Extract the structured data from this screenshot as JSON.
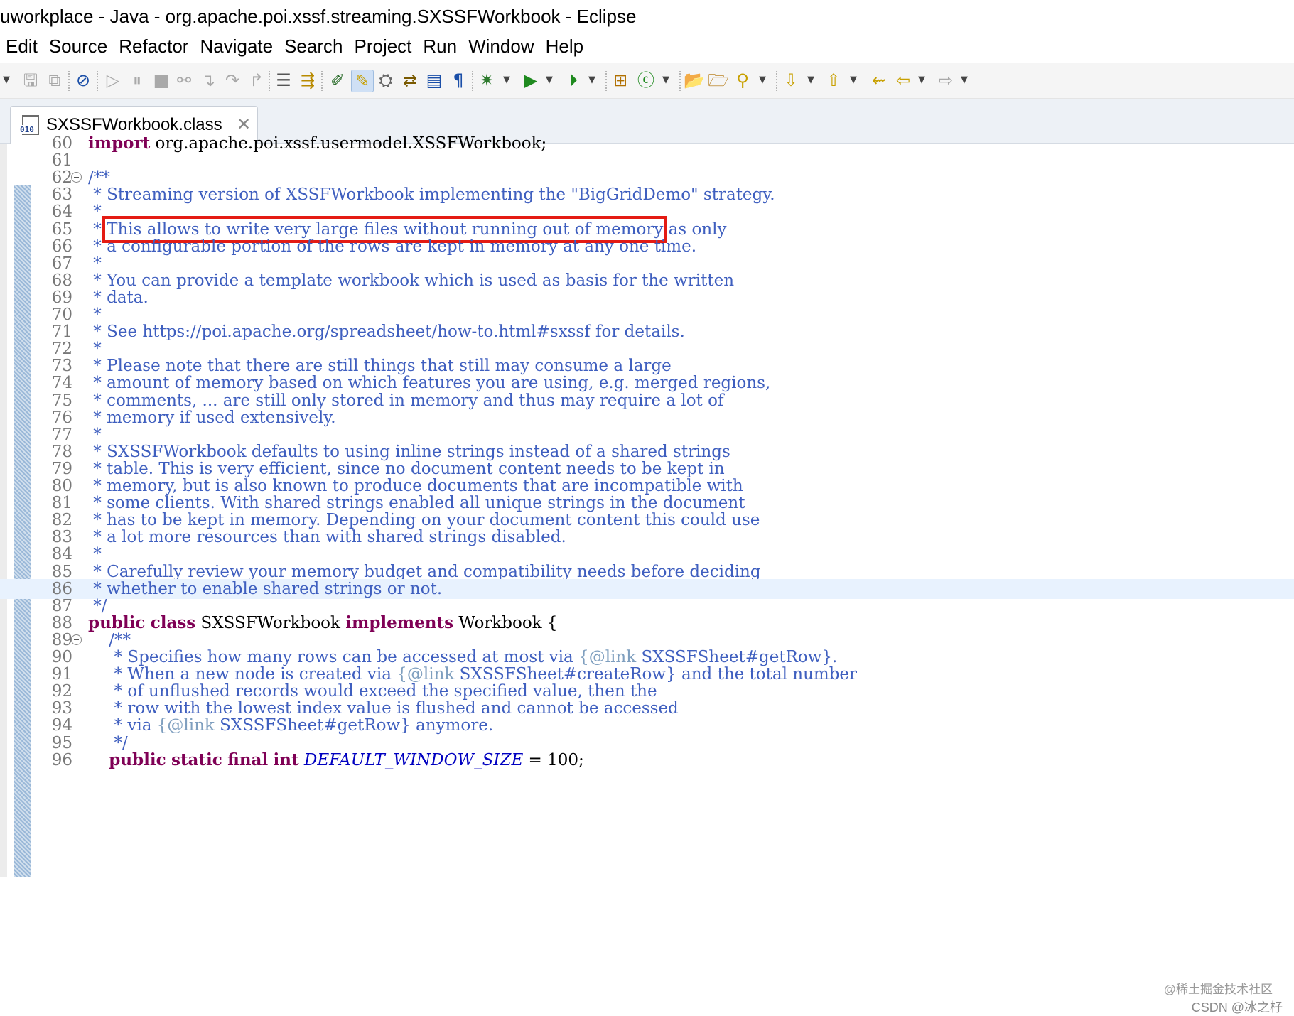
{
  "window": {
    "title": "uworkplace - Java - org.apache.poi.xssf.streaming.SXSSFWorkbook - Eclipse"
  },
  "menu": [
    "Edit",
    "Source",
    "Refactor",
    "Navigate",
    "Search",
    "Project",
    "Run",
    "Window",
    "Help"
  ],
  "toolbar": {
    "icons": [
      "dropdown",
      "save",
      "save-all",
      "skip-all-breakpoints",
      "resume",
      "suspend",
      "terminate",
      "disconnect",
      "step-into",
      "step-over",
      "step-return",
      "drop-to-frame",
      "use-step-filters",
      "toggle-breakpoint",
      "mark-occurrences",
      "toggle-block-selection",
      "show-whitespace",
      "debug",
      "run",
      "run-external",
      "new-java-package",
      "new-java-class",
      "open-type",
      "open-task",
      "search",
      "next-annotation",
      "previous-annotation",
      "last-edit",
      "back",
      "forward"
    ]
  },
  "tab": {
    "label": "SXSSFWorkbook.class"
  },
  "editor": {
    "current_line": 86,
    "lines": [
      {
        "n": "60",
        "segs": [
          {
            "k": "k",
            "t": "import"
          },
          {
            "k": "p",
            "t": " org.apache.poi.xssf.usermodel.XSSFWorkbook;"
          }
        ]
      },
      {
        "n": "61",
        "segs": []
      },
      {
        "n": "62",
        "fold": true,
        "segs": [
          {
            "k": "c",
            "t": "/**"
          }
        ]
      },
      {
        "n": "63",
        "segs": [
          {
            "k": "c",
            "t": " * Streaming version of XSSFWorkbook implementing the \"BigGridDemo\" strategy."
          }
        ]
      },
      {
        "n": "64",
        "segs": [
          {
            "k": "c",
            "t": " *"
          }
        ]
      },
      {
        "n": "65",
        "segs": [
          {
            "k": "c",
            "t": " * "
          },
          {
            "k": "hl",
            "t": "This allows to write very large files without running out of memory"
          },
          {
            "k": "c",
            "t": " as only"
          }
        ]
      },
      {
        "n": "66",
        "segs": [
          {
            "k": "c",
            "t": " * a configurable portion of the rows are kept in memory at any one time."
          }
        ]
      },
      {
        "n": "67",
        "segs": [
          {
            "k": "c",
            "t": " *"
          }
        ]
      },
      {
        "n": "68",
        "segs": [
          {
            "k": "c",
            "t": " * You can provide a template workbook which is used as basis for the written"
          }
        ]
      },
      {
        "n": "69",
        "segs": [
          {
            "k": "c",
            "t": " * data."
          }
        ]
      },
      {
        "n": "70",
        "segs": [
          {
            "k": "c",
            "t": " *"
          }
        ]
      },
      {
        "n": "71",
        "segs": [
          {
            "k": "c",
            "t": " * See https://poi.apache.org/spreadsheet/how-to.html#sxssf for details."
          }
        ]
      },
      {
        "n": "72",
        "segs": [
          {
            "k": "c",
            "t": " *"
          }
        ]
      },
      {
        "n": "73",
        "segs": [
          {
            "k": "c",
            "t": " * Please note that there are still things that still may consume a large"
          }
        ]
      },
      {
        "n": "74",
        "segs": [
          {
            "k": "c",
            "t": " * amount of memory based on which features you are using, e.g. merged regions,"
          }
        ]
      },
      {
        "n": "75",
        "segs": [
          {
            "k": "c",
            "t": " * comments, ... are still only stored in memory and thus may require a lot of"
          }
        ]
      },
      {
        "n": "76",
        "segs": [
          {
            "k": "c",
            "t": " * memory if used extensively."
          }
        ]
      },
      {
        "n": "77",
        "segs": [
          {
            "k": "c",
            "t": " *"
          }
        ]
      },
      {
        "n": "78",
        "segs": [
          {
            "k": "c",
            "t": " * SXSSFWorkbook defaults to using inline strings instead of a shared strings"
          }
        ]
      },
      {
        "n": "79",
        "segs": [
          {
            "k": "c",
            "t": " * table. This is very efficient, since no document content needs to be kept in"
          }
        ]
      },
      {
        "n": "80",
        "segs": [
          {
            "k": "c",
            "t": " * memory, but is also known to produce documents that are incompatible with"
          }
        ]
      },
      {
        "n": "81",
        "segs": [
          {
            "k": "c",
            "t": " * some clients. With shared strings enabled all unique strings in the document"
          }
        ]
      },
      {
        "n": "82",
        "segs": [
          {
            "k": "c",
            "t": " * has to be kept in memory. Depending on your document content this could use"
          }
        ]
      },
      {
        "n": "83",
        "segs": [
          {
            "k": "c",
            "t": " * a lot more resources than with shared strings disabled."
          }
        ]
      },
      {
        "n": "84",
        "segs": [
          {
            "k": "c",
            "t": " *"
          }
        ]
      },
      {
        "n": "85",
        "segs": [
          {
            "k": "c",
            "t": " * Carefully review your memory budget and compatibility needs before deciding"
          }
        ]
      },
      {
        "n": "86",
        "segs": [
          {
            "k": "c",
            "t": " * whether to enable shared strings or not."
          }
        ]
      },
      {
        "n": "87",
        "segs": [
          {
            "k": "c",
            "t": " */"
          }
        ]
      },
      {
        "n": "88",
        "segs": [
          {
            "k": "k",
            "t": "public"
          },
          {
            "k": "p",
            "t": " "
          },
          {
            "k": "k",
            "t": "class"
          },
          {
            "k": "p",
            "t": " SXSSFWorkbook "
          },
          {
            "k": "k",
            "t": "implements"
          },
          {
            "k": "p",
            "t": " Workbook {"
          }
        ]
      },
      {
        "n": "89",
        "fold": true,
        "segs": [
          {
            "k": "c",
            "t": "    /**"
          }
        ]
      },
      {
        "n": "90",
        "segs": [
          {
            "k": "c",
            "t": "     * Specifies how many rows can be accessed at most via "
          },
          {
            "k": "t",
            "t": "{@link"
          },
          {
            "k": "c",
            "t": " SXSSFSheet#getRow}."
          }
        ]
      },
      {
        "n": "91",
        "segs": [
          {
            "k": "c",
            "t": "     * When a new node is created via "
          },
          {
            "k": "t",
            "t": "{@link"
          },
          {
            "k": "c",
            "t": " SXSSFSheet#createRow} and the total number"
          }
        ]
      },
      {
        "n": "92",
        "segs": [
          {
            "k": "c",
            "t": "     * of unflushed records would exceed the specified value, then the"
          }
        ]
      },
      {
        "n": "93",
        "segs": [
          {
            "k": "c",
            "t": "     * row with the lowest index value is flushed and cannot be accessed"
          }
        ]
      },
      {
        "n": "94",
        "segs": [
          {
            "k": "c",
            "t": "     * via "
          },
          {
            "k": "t",
            "t": "{@link"
          },
          {
            "k": "c",
            "t": " SXSSFSheet#getRow} anymore."
          }
        ]
      },
      {
        "n": "95",
        "segs": [
          {
            "k": "c",
            "t": "     */"
          }
        ]
      },
      {
        "n": "96",
        "segs": [
          {
            "k": "p",
            "t": "    "
          },
          {
            "k": "k",
            "t": "public"
          },
          {
            "k": "p",
            "t": " "
          },
          {
            "k": "k",
            "t": "static"
          },
          {
            "k": "p",
            "t": " "
          },
          {
            "k": "k",
            "t": "final"
          },
          {
            "k": "p",
            "t": " "
          },
          {
            "k": "k",
            "t": "int"
          },
          {
            "k": "p",
            "t": " "
          },
          {
            "k": "f",
            "t": "DEFAULT_WINDOW_SIZE"
          },
          {
            "k": "p",
            "t": " = 100;"
          }
        ]
      }
    ]
  },
  "watermark": {
    "line1": "@稀土掘金技术社区",
    "line2": "CSDN @冰之杍"
  },
  "colors": {
    "comment": "#3f5fbf",
    "keyword": "#7f0055",
    "javadoc_tag": "#7f9fbf",
    "annotation_box": "#e41b13",
    "current_line": "#e8f2fe"
  }
}
